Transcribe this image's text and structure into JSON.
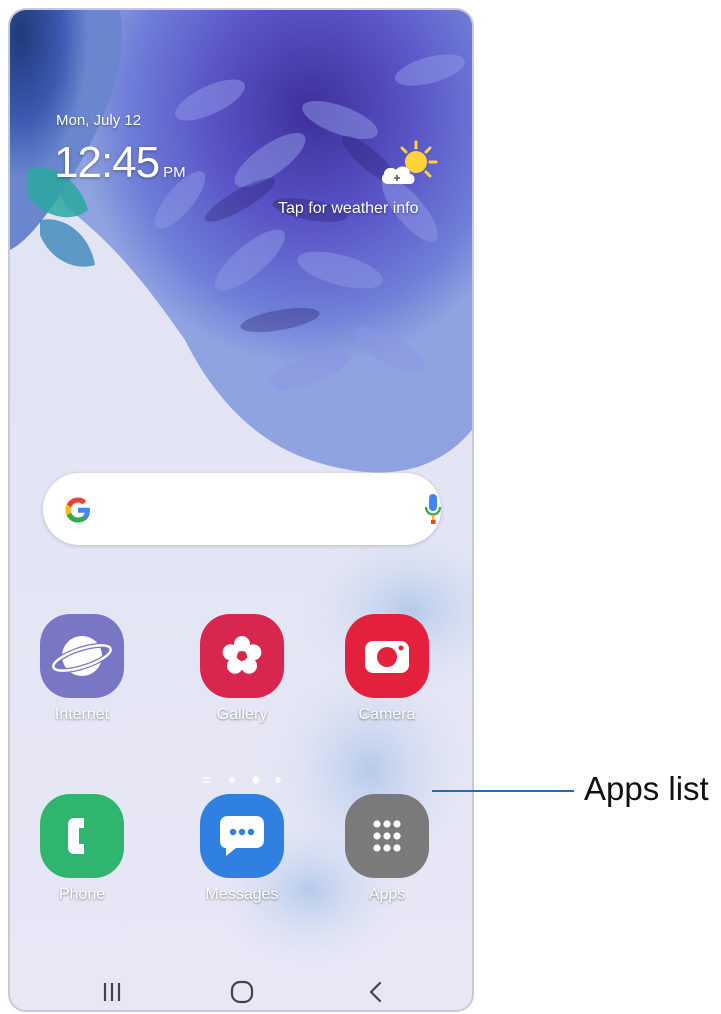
{
  "lockscreen": {
    "date": "Mon, July 12",
    "time": "12:45",
    "ampm": "PM",
    "weather_prompt": "Tap for weather info"
  },
  "search_bar": {
    "logo": "google-g-icon",
    "mic": "mic-icon"
  },
  "apps_row1": [
    {
      "label": "Internet",
      "icon": "internet-icon",
      "color": "#7a76c6"
    },
    {
      "label": "Gallery",
      "icon": "gallery-icon",
      "color": "#d8264f"
    },
    {
      "label": "Camera",
      "icon": "camera-icon",
      "color": "#e3213d"
    }
  ],
  "page_indicator": {
    "pages": 3,
    "current": 2
  },
  "dock": [
    {
      "label": "Phone",
      "icon": "phone-icon",
      "color": "#2fb56e"
    },
    {
      "label": "Messages",
      "icon": "messages-icon",
      "color": "#2f80e0"
    },
    {
      "label": "Apps",
      "icon": "apps-grid-icon",
      "color": "#7a7a7a"
    }
  ],
  "navigation": {
    "recents": "recents-icon",
    "home": "home-icon",
    "back": "back-icon"
  },
  "callout": {
    "label": "Apps list"
  }
}
